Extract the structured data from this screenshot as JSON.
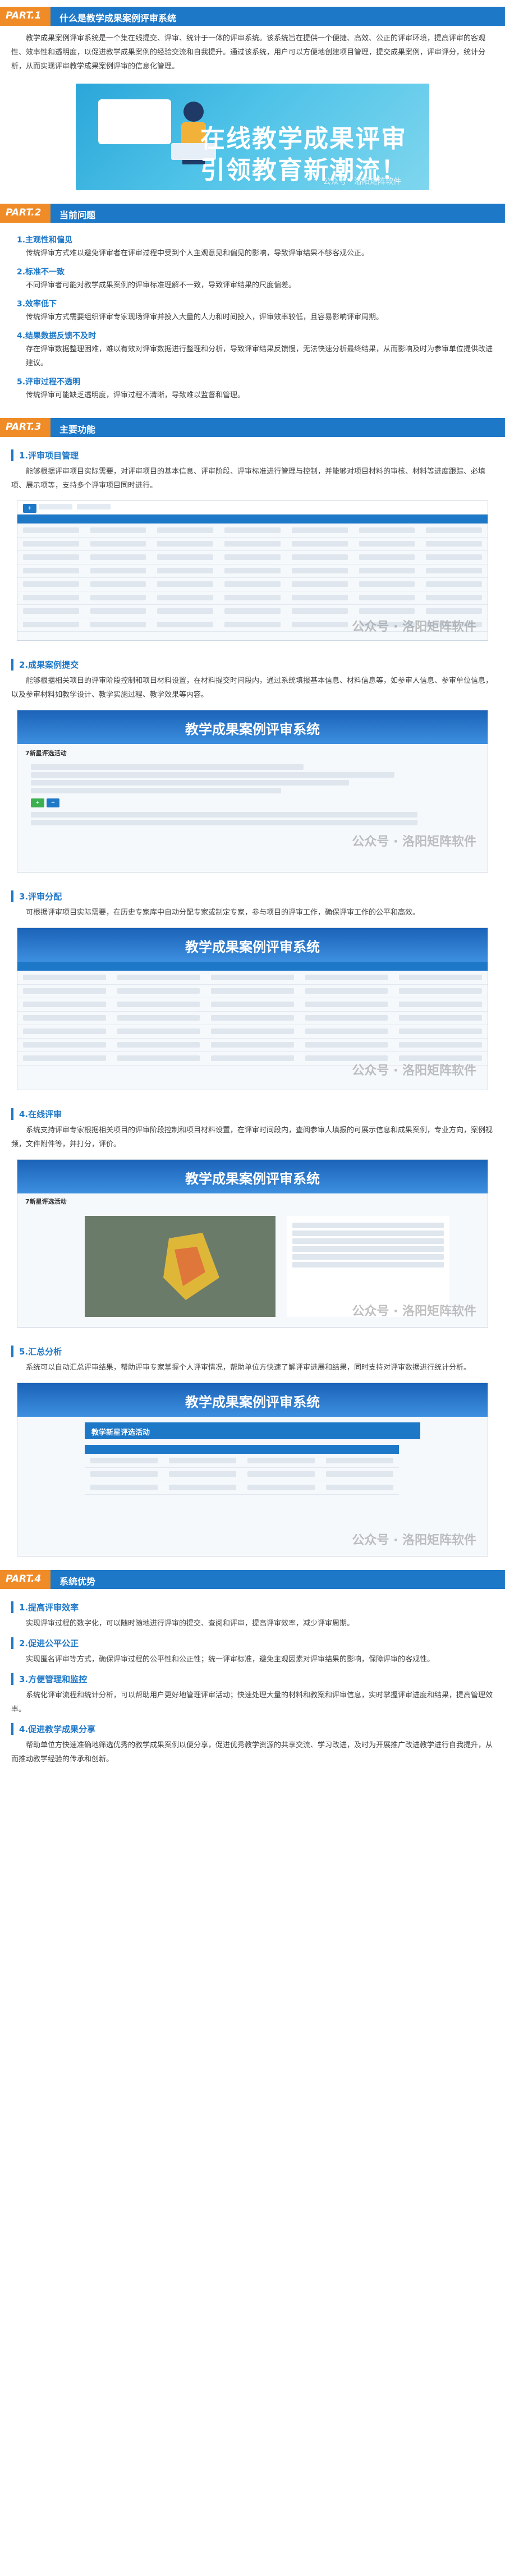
{
  "part1": {
    "tag": "PART.1",
    "title": "什么是教学成果案例评审系统",
    "para": "教学成果案例评审系统是一个集在线提交、评审、统计于一体的评审系统。该系统旨在提供一个便捷、高效、公正的评审环境，提高评审的客观性、效率性和透明度，以促进教学成果案例的经验交流和自我提升。通过该系统，用户可以方便地创建项目管理，提交成果案例，评审评分，统计分析，从而实现评审教学成果案例评审的信息化管理。",
    "banner_line1": "在线教学成果评审",
    "banner_line2": "引领教育新潮流！",
    "watermark": "公众号 · 洛阳矩阵软件"
  },
  "part2": {
    "tag": "PART.2",
    "title": "当前问题",
    "items": [
      {
        "head": "1.主观性和偏见",
        "text": "传统评审方式难以避免评审者在评审过程中受到个人主观意见和偏见的影响，导致评审结果不够客观公正。"
      },
      {
        "head": "2.标准不一致",
        "text": "不同评审者可能对教学成果案例的评审标准理解不一致，导致评审结果的尺度偏差。"
      },
      {
        "head": "3.效率低下",
        "text": "传统评审方式需要组织评审专家现场评审并投入大量的人力和时间投入，评审效率较低，且容易影响评审周期。"
      },
      {
        "head": "4.结果数据反馈不及时",
        "text": "存在评审数据整理困难，难以有效对评审数据进行整理和分析，导致评审结果反馈慢，无法快速分析最终结果，从而影响及时为参审单位提供改进建议。"
      },
      {
        "head": "5.评审过程不透明",
        "text": "传统评审可能缺乏透明度，评审过程不清晰，导致难以监督和管理。"
      }
    ]
  },
  "part3": {
    "tag": "PART.3",
    "title": "主要功能",
    "sections": [
      {
        "head": "1.评审项目管理",
        "text": "能够根据评审项目实际需要，对评审项目的基本信息、评审阶段、评审标准进行管理与控制，并能够对项目材料的审核、材料等进度跟踪、必填项、展示项等，支持多个评审项目同时进行。"
      },
      {
        "head": "2.成果案例提交",
        "text": "能够根据相关项目的评审阶段控制和项目材料设置，在材料提交时间段内，通过系统填报基本信息、材料信息等，如参审人信息、参审单位信息，以及参审材料如教学设计、教学实施过程、教学效果等内容。"
      },
      {
        "head": "3.评审分配",
        "text": "可根据评审项目实际需要，在历史专家库中自动分配专家或制定专家，参与项目的评审工作，确保评审工作的公平和高效。"
      },
      {
        "head": "4.在线评审",
        "text": "系统支持评审专家根据相关项目的评审阶段控制和项目材料设置，在评审时间段内，查阅参审人填报的可展示信息和成果案例，专业方向，案例视频，文件附件等，并打分，评价。"
      },
      {
        "head": "5.汇总分析",
        "text": "系统可以自动汇总评审结果，帮助评审专家掌握个人评审情况，帮助单位方快速了解评审进展和结果，同时支持对评审数据进行统计分析。"
      }
    ],
    "system_name": "教学成果案例评审系统",
    "screen2_title": "7新星评选活动",
    "screen5_title": "教学新星评选活动",
    "watermark": "公众号 · 洛阳矩阵软件"
  },
  "part4": {
    "tag": "PART.4",
    "title": "系统优势",
    "items": [
      {
        "head": "1.提高评审效率",
        "text": "实现评审过程的数字化，可以随时随地进行评审的提交、查阅和评审，提高评审效率，减少评审周期。"
      },
      {
        "head": "2.促进公平公正",
        "text": "实现匿名评审等方式，确保评审过程的公平性和公正性；统一评审标准，避免主观因素对评审结果的影响，保障评审的客观性。"
      },
      {
        "head": "3.方便管理和监控",
        "text": "系统化评审流程和统计分析，可以帮助用户更好地管理评审活动；快速处理大量的材料和教案和评审信息，实时掌握评审进度和结果，提高管理效率。"
      },
      {
        "head": "4.促进教学成果分享",
        "text": "帮助单位方快速准确地筛选优秀的教学成果案例以便分享，促进优秀教学资源的共享交流、学习改进，及时为开展推广改进教学进行自我提升，从而推动教学经验的传承和创新。"
      }
    ]
  }
}
